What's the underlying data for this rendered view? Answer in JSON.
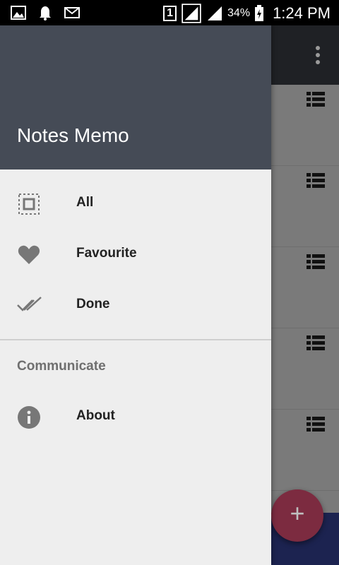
{
  "status_bar": {
    "sim_slot": "1",
    "battery_percent": "34%",
    "time": "1:24 PM",
    "left_icons": [
      "gallery-icon",
      "bell-icon",
      "mail-icon"
    ]
  },
  "drawer": {
    "title": "Notes Memo",
    "items": [
      {
        "label": "All",
        "icon": "select-all-icon"
      },
      {
        "label": "Favourite",
        "icon": "heart-icon"
      },
      {
        "label": "Done",
        "icon": "double-check-icon"
      }
    ],
    "section_label": "Communicate",
    "section_items": [
      {
        "label": "About",
        "icon": "info-icon"
      }
    ]
  },
  "fab": {
    "label": "+"
  },
  "colors": {
    "header": "#454b56",
    "drawer_bg": "#eeeeee",
    "appbar": "#1f2125",
    "fab": "#7c2b40",
    "bottom_bar": "#1c2350"
  }
}
